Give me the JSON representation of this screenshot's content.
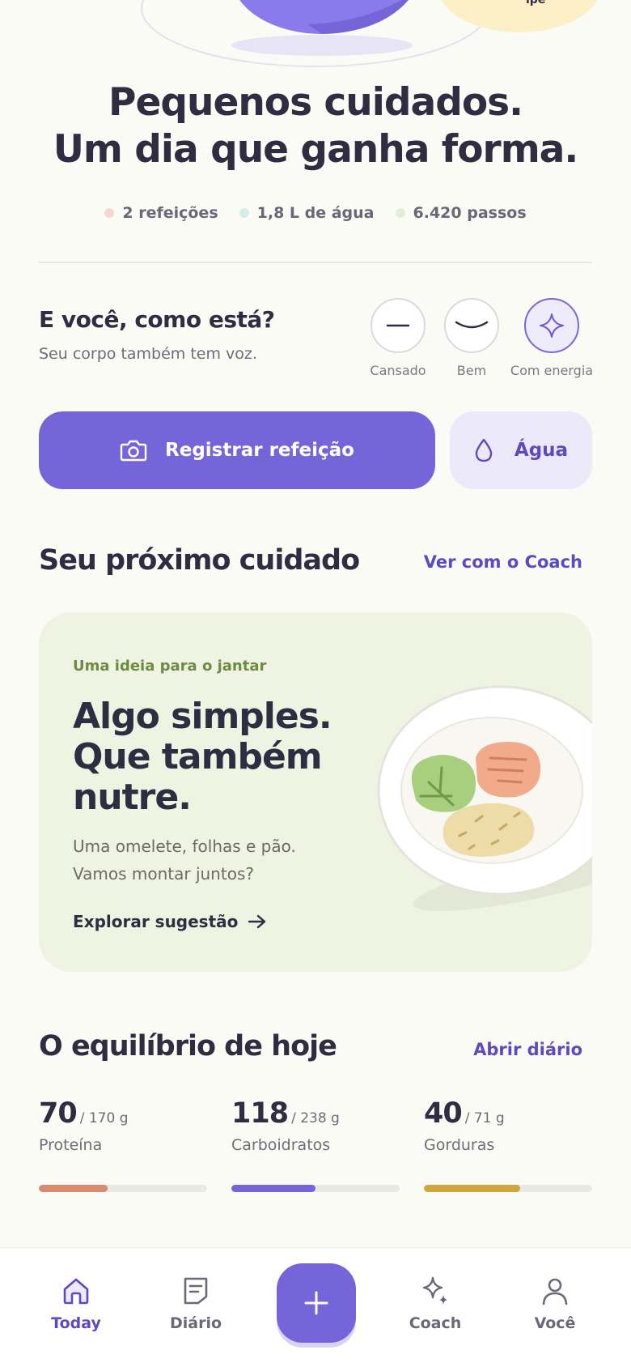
{
  "hero": {
    "headline_line1": "Pequenos cuidados.",
    "headline_line2": "Um dia que ganha forma.",
    "stats": [
      {
        "label": "2 refeições",
        "color": "#F6D6D2"
      },
      {
        "label": "1,8 L de água",
        "color": "#D3EEEA"
      },
      {
        "label": "6.420 passos",
        "color": "#E2EED5"
      }
    ]
  },
  "mood": {
    "title": "E você, como está?",
    "subtitle": "Seu corpo também tem voz.",
    "options": [
      {
        "label": "Cansado",
        "icon": "flat-line-icon",
        "selected": false
      },
      {
        "label": "Bem",
        "icon": "smile-curve-icon",
        "selected": false
      },
      {
        "label": "Com energia",
        "icon": "sparkle-icon",
        "selected": true
      }
    ]
  },
  "actions": {
    "register_meal": "Registrar refeição",
    "water": "Água"
  },
  "next_care": {
    "title": "Seu próximo cuidado",
    "link": "Ver com o Coach",
    "card": {
      "eyebrow": "Uma ideia para o jantar",
      "title_line1": "Algo simples.",
      "title_line2": "Que também",
      "title_line3": "nutre.",
      "body_line1": "Uma omelete, folhas e pão.",
      "body_line2": "Vamos montar juntos?",
      "cta": "Explorar sugestão"
    }
  },
  "balance": {
    "title": "O equilíbrio de hoje",
    "link": "Abrir diário",
    "macros": [
      {
        "value": "70",
        "goal": "/ 170 g",
        "label": "Proteína",
        "progress": 0.41,
        "color": "#D98A70"
      },
      {
        "value": "118",
        "goal": "/ 238 g",
        "label": "Carboidratos",
        "progress": 0.5,
        "color": "#7565D8"
      },
      {
        "value": "40",
        "goal": "/ 71 g",
        "label": "Gorduras",
        "progress": 0.57,
        "color": "#D2A63E"
      }
    ]
  },
  "nav": {
    "today": "Today",
    "diary": "Diário",
    "coach": "Coach",
    "you": "Você"
  },
  "colors": {
    "accent": "#7565D8",
    "accent_dark": "#5A4BC0",
    "background": "#FBFBF5",
    "card_green": "#EEF4E1"
  }
}
